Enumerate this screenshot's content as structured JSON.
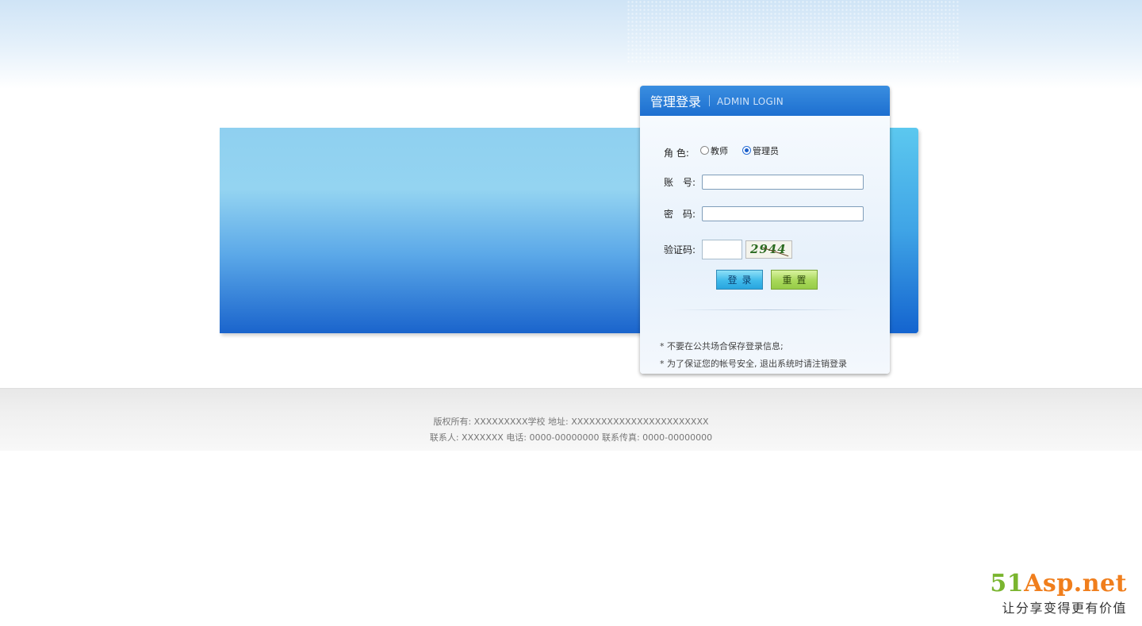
{
  "login": {
    "title": "管理登录",
    "subtitle": "ADMIN LOGIN",
    "role_label": "角 色:",
    "roles": [
      {
        "label": "教师",
        "checked": false
      },
      {
        "label": "管理员",
        "checked": true
      }
    ],
    "account_label": "账　号:",
    "account_value": "",
    "password_label": "密　码:",
    "password_value": "",
    "captcha_label": "验证码:",
    "captcha_value": "",
    "captcha_text": "2944",
    "login_button": "登录",
    "reset_button": "重置",
    "tips": [
      "* 不要在公共场合保存登录信息;",
      "* 为了保证您的帐号安全, 退出系统时请注销登录"
    ]
  },
  "footer": {
    "line1": "版权所有: XXXXXXXXX学校 地址: XXXXXXXXXXXXXXXXXXXXXXX",
    "line2": "联系人: XXXXXXX 电话: 0000-00000000 联系传真: 0000-00000000"
  },
  "brand": {
    "logo_number": "51",
    "logo_name": "Asp.net",
    "slogan": "让分享变得更有价值"
  },
  "colors": {
    "header_blue": "#1d6fd0",
    "banner_bottom": "#1a64cc",
    "brand_green": "#7ab52f",
    "brand_orange": "#f07e1c"
  }
}
